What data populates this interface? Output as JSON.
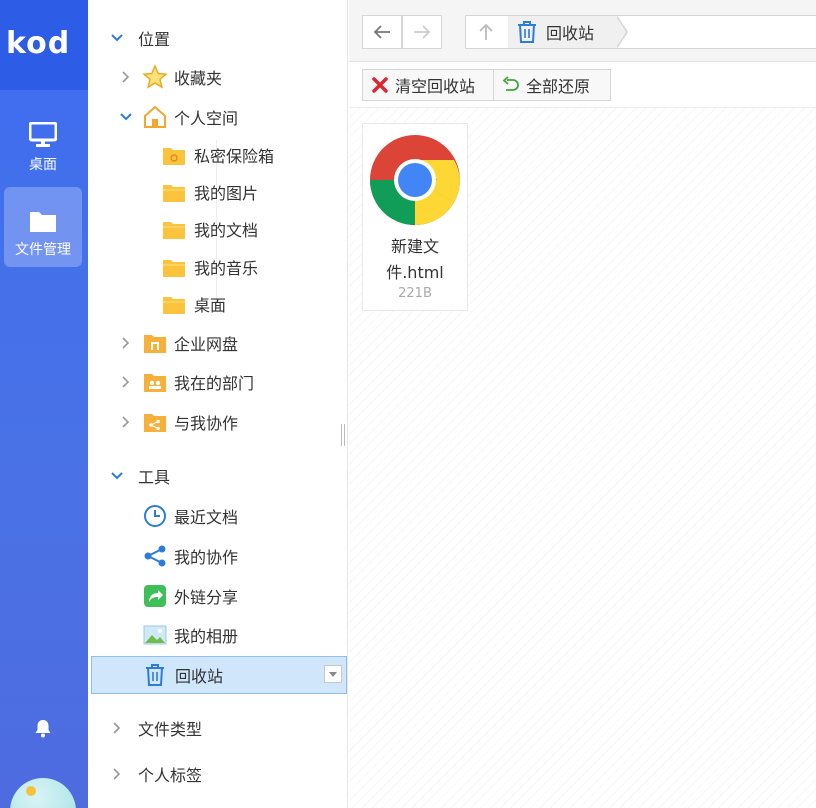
{
  "app": {
    "logo": "kod"
  },
  "rail": {
    "items": [
      {
        "label": "桌面",
        "icon": "monitor-icon"
      },
      {
        "label": "文件管理",
        "icon": "folder-icon"
      }
    ],
    "bell_icon": "bell-icon"
  },
  "tree": {
    "sections": {
      "location": "位置",
      "tools": "工具",
      "file_types": "文件类型",
      "personal_tags": "个人标签"
    },
    "items": {
      "favorites": "收藏夹",
      "personal_space": "个人空间",
      "private_vault": "私密保险箱",
      "my_pictures": "我的图片",
      "my_documents": "我的文档",
      "my_music": "我的音乐",
      "desktop": "桌面",
      "enterprise_disk": "企业网盘",
      "my_department": "我在的部门",
      "collab_with_me": "与我协作",
      "recent_docs": "最近文档",
      "my_collab": "我的协作",
      "external_share": "外链分享",
      "my_album": "我的相册",
      "recycle_bin": "回收站"
    }
  },
  "breadcrumb": {
    "current": "回收站"
  },
  "toolbar": {
    "empty_label": "清空回收站",
    "restore_label": "全部还原"
  },
  "files": [
    {
      "name": "新建文件.html",
      "name_line1": "新建文",
      "name_line2": "件.html",
      "size": "221B",
      "icon": "chrome-icon"
    }
  ],
  "colors": {
    "rail": "#3d6df0",
    "accent_blue": "#2d7cd8",
    "folder_yellow": "#fcc43c",
    "selected_bg": "#cfe6fb",
    "danger_red": "#d9282f",
    "restore_green": "#3aa53a"
  }
}
